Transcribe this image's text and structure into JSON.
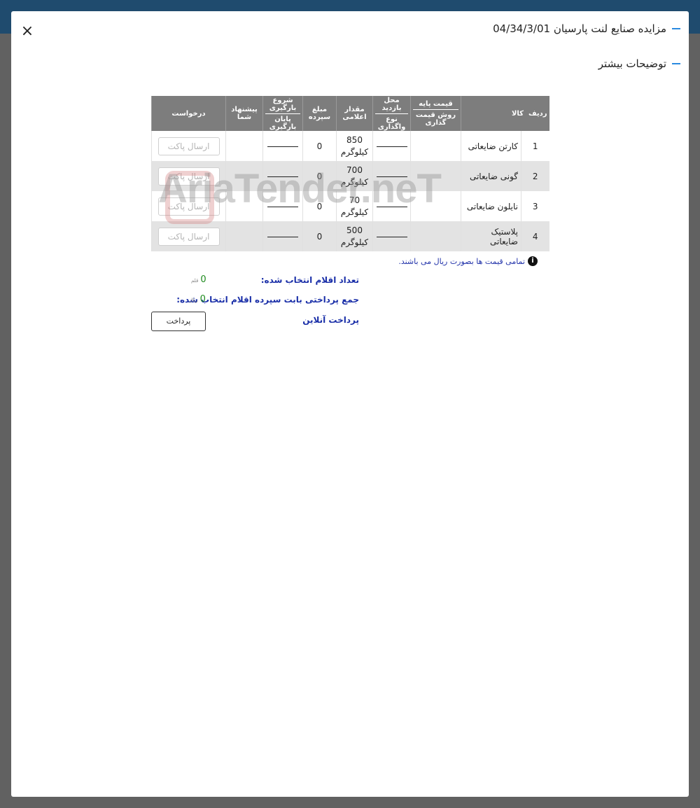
{
  "modal": {
    "title": "مزایده صنایع لنت پارسیان 04/34/3/01",
    "more_title": "توضیحات بیشتر",
    "close": "×"
  },
  "table": {
    "headers": {
      "row": "ردیف",
      "item": "کالا",
      "base_price": "قیمت پایه",
      "pricing_method": "روش قیمت گذاری",
      "visit_place": "محل بازدید",
      "delivery_type": "نوع واگذاری",
      "announced_qty": "مقدار اعلامی",
      "deposit": "مبلغ سپرده",
      "load_start": "شروع بارگیری",
      "load_end": "پایان بارگیری",
      "your_offer": "پیشنهاد شما",
      "request": "درخواست"
    },
    "rows": [
      {
        "index": "1",
        "name": "کارتن ضایعاتی",
        "qty": "850",
        "unit": "کیلوگرم",
        "deposit": "0",
        "button": "ارسال پاکت"
      },
      {
        "index": "2",
        "name": "گونی ضایعاتی",
        "qty": "700",
        "unit": "کیلوگرم",
        "deposit": "0",
        "button": "ارسال پاکت"
      },
      {
        "index": "3",
        "name": "نایلون ضایعاتی",
        "qty": "70",
        "unit": "کیلوگرم",
        "deposit": "0",
        "button": "ارسال پاکت"
      },
      {
        "index": "4",
        "name": "پلاستیک ضایعاتی",
        "qty": "500",
        "unit": "کیلوگرم",
        "deposit": "0",
        "button": "ارسال پاکت"
      }
    ]
  },
  "watermark": "AriaTender.neT",
  "note": "تمامی قیمت ها بصورت ریال می باشند.",
  "summary": {
    "count_label": "تعداد اقلام انتخاب شده:",
    "count_value": "0",
    "count_unit": "قلم",
    "total_label": "جمع پرداختی بابت سپرده اقلام انتخاب شده:",
    "total_value": "0",
    "total_unit": "ریال",
    "online_label": "پرداخت آنلاین",
    "pay_button": "پرداخت"
  }
}
